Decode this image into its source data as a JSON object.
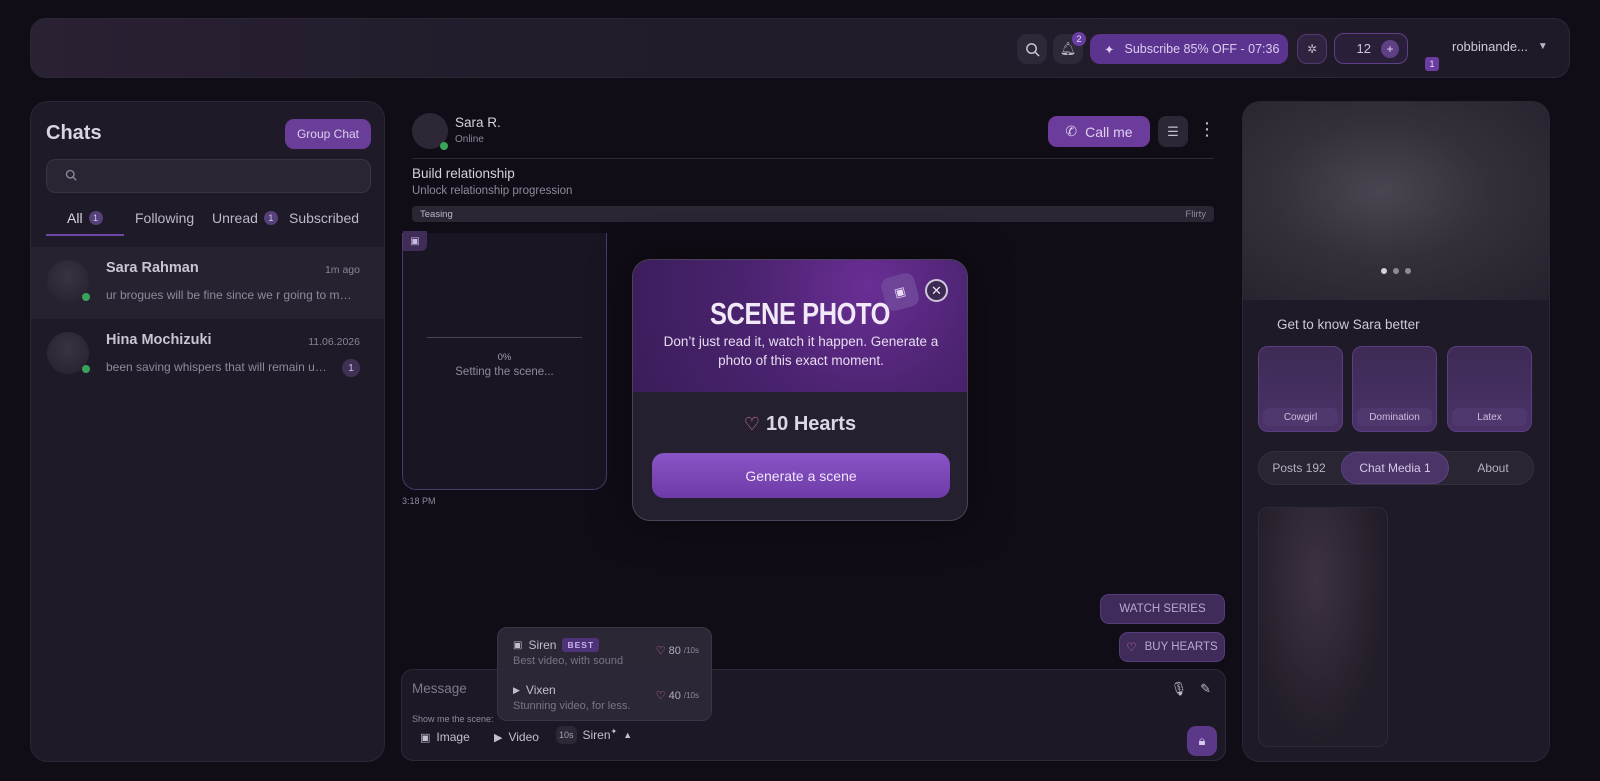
{
  "topbar": {
    "notifications_count": "2",
    "subscribe_label": "Subscribe 85% OFF - 07:36",
    "hearts_balance": "12",
    "hearts_plus": "+",
    "username": "robbinande...",
    "user_badge": "1"
  },
  "chats": {
    "title": "Chats",
    "group_chat_label": "Group Chat",
    "search_placeholder": "",
    "tabs": [
      {
        "label": "All",
        "count": "1"
      },
      {
        "label": "Following"
      },
      {
        "label": "Unread",
        "count": "1"
      },
      {
        "label": "Subscribed"
      }
    ],
    "items": [
      {
        "name": "Sara Rahman",
        "time": "1m ago",
        "preview": "ur brogues will be fine since we r going to my pri..."
      },
      {
        "name": "Hina Mochizuki",
        "time": "11.06.2026",
        "preview": "been saving whispers that will remain un...",
        "unread": "1"
      }
    ]
  },
  "conversation": {
    "contact_name": "Sara R.",
    "contact_status": "Online",
    "call_label": "Call me",
    "relationship_title": "Build relationship",
    "relationship_subtitle": "Unlock relationship progression",
    "relationship_level_left": "Teasing",
    "relationship_level_right": "Flirty",
    "scene_progress_percent": "0%",
    "scene_progress_value": 0,
    "scene_status": "Setting the scene...",
    "scene_time": "3:18 PM",
    "watch_series_label": "WATCH SERIES",
    "buy_hearts_label": "BUY HEARTS"
  },
  "composer": {
    "placeholder": "Message",
    "show_scene_label": "Show me the scene:",
    "image_label": "Image",
    "video_label": "Video",
    "duration": "10s",
    "selected_model": "Siren"
  },
  "model_dropdown": {
    "options": [
      {
        "name": "Siren",
        "badge": "BEST",
        "description": "Best video, with sound",
        "price": "80",
        "unit": "/10s"
      },
      {
        "name": "Vixen",
        "description": "Stunning video, for less.",
        "price": "40",
        "unit": "/10s"
      }
    ]
  },
  "modal": {
    "title": "SCENE PHOTO",
    "description": "Don’t just read it, watch it happen. Generate a photo of this exact moment.",
    "price": "10 Hearts",
    "generate_label": "Generate a scene"
  },
  "profile": {
    "know_title": "Get to know Sara better",
    "scenarios": [
      "Cowgirl",
      "Domination",
      "Latex"
    ],
    "tabs": [
      "Posts 192",
      "Chat Media 1",
      "About"
    ]
  },
  "colors": {
    "accent": "#6b3c9c",
    "background": "#110d17",
    "panel": "#1f1a27",
    "online": "#3aa35a"
  }
}
